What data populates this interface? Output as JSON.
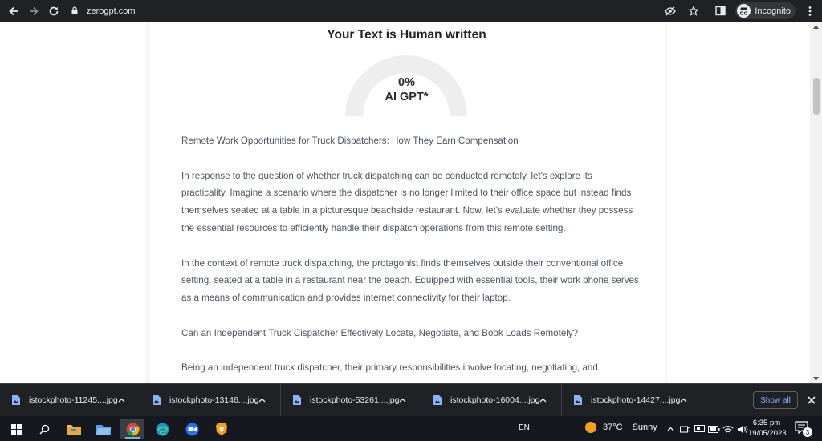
{
  "browser": {
    "url": "zerogpt.com",
    "profile_label": "Incognito"
  },
  "result": {
    "title": "Your Text is Human written",
    "percent": "0%",
    "label": "AI GPT*",
    "ai_fraction": 0
  },
  "article": {
    "paragraphs": [
      "Remote Work Opportunities for Truck Dispatchers: How They Earn Compensation",
      "In response to the question of whether truck dispatching can be conducted remotely, let's explore its practicality. Imagine a scenario where the dispatcher is no longer limited to their office space but instead finds themselves seated at a table in a picturesque beachside restaurant. Now, let's evaluate whether they possess the essential resources to efficiently handle their dispatch operations from this remote setting.",
      "In the context of remote truck dispatching, the protagonist finds themselves outside their conventional office setting, seated at a table in a restaurant near the beach. Equipped with essential tools, their work phone serves as a means of communication and provides internet connectivity for their laptop.",
      "Can an Independent Truck Cispatcher Effectively Locate, Negotiate, and Book Loads Remotely?",
      "Being an independent truck dispatcher, their primary responsibilities involve locating, negotiating, and"
    ]
  },
  "downloads": {
    "items": [
      "istockphoto-11245....jpg",
      "istockphoto-13146....jpg",
      "istockphoto-53261....jpg",
      "istockphoto-16004....jpg",
      "istockphoto-14427....jpg"
    ],
    "show_all_label": "Show all"
  },
  "taskbar": {
    "language": "EN",
    "temperature": "37°C",
    "condition": "Sunny",
    "time": "6:35 pm",
    "date": "19/05/2023",
    "notification_count": "3",
    "apps": [
      "windows-start-icon",
      "search-icon",
      "file-explorer-icon",
      "folder-app-icon",
      "chrome-icon",
      "edge-icon",
      "zoom-icon",
      "brave-icon"
    ]
  },
  "colors": {
    "browser_bar": "#202124",
    "gauge_track": "#eeeeee",
    "text": "#4d5562",
    "link_blue": "#8ab4f8",
    "taskbar": "#15191f"
  }
}
